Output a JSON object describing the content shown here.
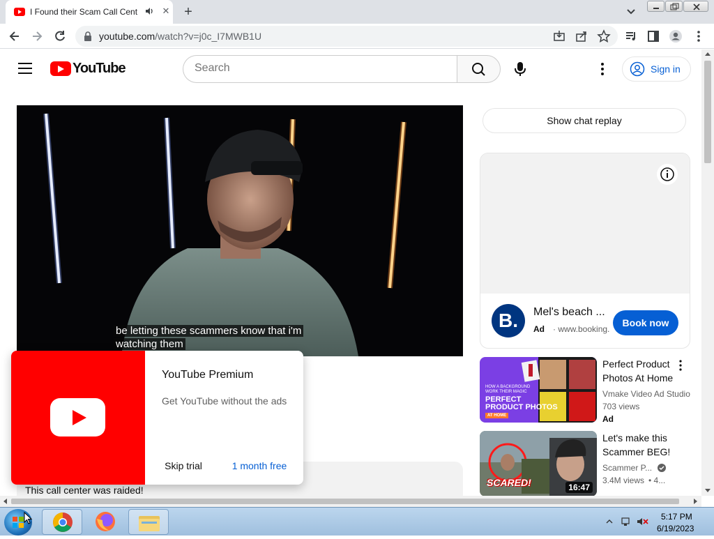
{
  "browser": {
    "tab_title": "I Found their Scam Call Cent",
    "new_tab": "+",
    "url_host": "youtube.com",
    "url_path": "/watch?v=j0c_I7MWB1U"
  },
  "youtube": {
    "logo_text": "YouTube",
    "search_placeholder": "Search",
    "signin_label": "Sign in"
  },
  "video": {
    "caption_line1": "be letting these scammers know that i'm",
    "caption_line2": "watching them"
  },
  "sidebar": {
    "chat_replay": "Show chat replay",
    "ad": {
      "logo_letter": "B.",
      "title": "Mel's beach ...",
      "badge": "Ad",
      "domain": "· www.booking.",
      "cta": "Book now"
    },
    "recommendations": [
      {
        "title": "Perfect Product Photos At Home",
        "channel": "Vmake Video Ad Studio",
        "views": "703 views",
        "badge": "Ad",
        "thumb_text_1": "PERFECT",
        "thumb_text_2": "PRODUCT PHOTOS",
        "thumb_text_3": "AT HOME",
        "thumb_small": "HOW A BACKGROUND WORK THEIR MAGIC"
      },
      {
        "title": "Let's make this Scammer BEG!",
        "channel": "Scammer P...",
        "views": "3.4M views",
        "age": "• 4...",
        "duration": "16:47",
        "thumb_text": "SCARED!"
      }
    ]
  },
  "description": {
    "text": "This call center was raided!"
  },
  "premium_popup": {
    "title": "YouTube Premium",
    "subtitle": "Get YouTube without the ads",
    "skip": "Skip trial",
    "accept": "1 month free"
  },
  "taskbar": {
    "time": "5:17 PM",
    "date": "6/19/2023"
  },
  "colors": {
    "youtube_red": "#ff0000",
    "link_blue": "#065fd4",
    "booking_blue": "#003580"
  }
}
